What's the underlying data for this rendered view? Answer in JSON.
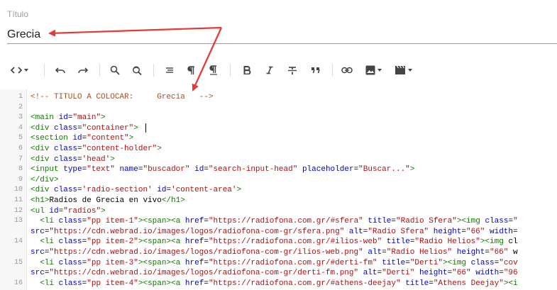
{
  "title_field": {
    "label": "Título",
    "value": "Grecia"
  },
  "toolbar": {
    "icons": [
      "code-view-icon",
      "undo-icon",
      "redo-icon",
      "search-icon",
      "replace-icon",
      "align-icon",
      "paragraph-icon",
      "paragraph-rtl-icon",
      "bold-icon",
      "italic-icon",
      "strikethrough-icon",
      "quote-icon",
      "link-icon",
      "image-icon",
      "video-icon"
    ]
  },
  "code_lines": [
    {
      "n": "1",
      "text": "<!-- TITULO A COLOCAR:     Grecia   -->"
    },
    {
      "n": "2",
      "text": ""
    },
    {
      "n": "3",
      "text": "<main id=\"main\">"
    },
    {
      "n": "4",
      "text": "<div class=\"container\">"
    },
    {
      "n": "5",
      "text": "<section id=\"content\">"
    },
    {
      "n": "6",
      "text": "<div class=\"content-holder\">"
    },
    {
      "n": "7",
      "text": "<div class='head'>"
    },
    {
      "n": "8",
      "text": "<input type=\"text\" name=\"buscador\" id=\"search-input-head\" placeholder=\"Buscar...\">"
    },
    {
      "n": "9",
      "text": "</div>"
    },
    {
      "n": "10",
      "text": "<div class='radio-section' id='content-area'>"
    },
    {
      "n": "11",
      "text": "<h1>Radios de Grecia en vivo</h1>"
    },
    {
      "n": "12",
      "text": "<ul id=\"radios\">"
    },
    {
      "n": "13",
      "text": "  <li class=\"pp item-1\"><span><a href=\"https://radiofona.com.gr/#sfera\" title=\"Radio Sfera\"><img class=\""
    },
    {
      "n": "",
      "text": "src=\"https://cdn.webrad.io/images/logos/radiofona-com-gr/sfera.png\" alt=\"Radio Sfera\" height=\"66\" width="
    },
    {
      "n": "14",
      "text": "  <li class=\"pp item-2\"><span><a href=\"https://radiofona.com.gr/#ilios-web\" title=\"Radio Helios\"><img cl"
    },
    {
      "n": "",
      "text": "src=\"https://cdn.webrad.io/images/logos/radiofona-com-gr/ilios-web.png\" alt=\"Radio Helios\" height=\"66\" w"
    },
    {
      "n": "15",
      "text": "  <li class=\"pp item-3\"><span><a href=\"https://radiofona.com.gr/#derti-fm\" title=\"Derti\"><img class=\"cov"
    },
    {
      "n": "",
      "text": "src=\"https://cdn.webrad.io/images/logos/radiofona-com-gr/derti-fm.png\" alt=\"Derti\" height=\"66\" width=\"96"
    },
    {
      "n": "16",
      "text": "  <li class=\"pp item-4\"><span><a href=\"https://radiofona.com.gr/#athens-deejay\" title=\"Athens Deejay\"><i"
    }
  ],
  "colors": {
    "accent_underline": "#e08a43",
    "annotation_arrow": "#e53935",
    "comment": "#a0522d",
    "tag": "#117700",
    "attribute": "#0000cc",
    "string": "#aa1111"
  }
}
